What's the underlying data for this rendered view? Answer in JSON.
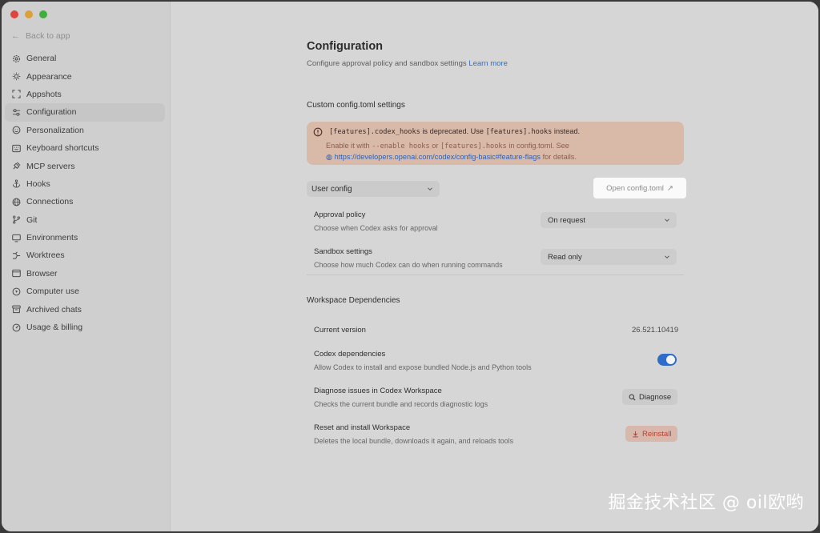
{
  "window": {
    "traffic_lights": [
      "red",
      "yellow",
      "green"
    ]
  },
  "sidebar": {
    "back_label": "Back to app",
    "items": [
      {
        "label": "General",
        "icon": "gear-icon"
      },
      {
        "label": "Appearance",
        "icon": "sun-icon"
      },
      {
        "label": "Appshots",
        "icon": "capture-icon"
      },
      {
        "label": "Configuration",
        "icon": "sliders-icon",
        "active": true
      },
      {
        "label": "Personalization",
        "icon": "smile-icon"
      },
      {
        "label": "Keyboard shortcuts",
        "icon": "keyboard-icon"
      },
      {
        "label": "MCP servers",
        "icon": "plug-icon"
      },
      {
        "label": "Hooks",
        "icon": "anchor-icon"
      },
      {
        "label": "Connections",
        "icon": "globe-icon"
      },
      {
        "label": "Git",
        "icon": "branch-icon"
      },
      {
        "label": "Environments",
        "icon": "monitor-icon"
      },
      {
        "label": "Worktrees",
        "icon": "tree-icon"
      },
      {
        "label": "Browser",
        "icon": "browser-icon"
      },
      {
        "label": "Computer use",
        "icon": "cursor-icon"
      },
      {
        "label": "Archived chats",
        "icon": "archive-icon"
      },
      {
        "label": "Usage & billing",
        "icon": "gauge-icon"
      }
    ]
  },
  "main": {
    "title": "Configuration",
    "subtitle": "Configure approval policy and sandbox settings",
    "learn_more": "Learn more",
    "custom_section": "Custom config.toml settings",
    "warning": {
      "code1": "[features].codex_hooks",
      "text1": "is deprecated. Use",
      "code2": "[features].hooks",
      "text2": "instead.",
      "line2_a": "Enable it with",
      "code3": "--enable hooks",
      "line2_b": "or",
      "code4": "[features].hooks",
      "line2_c": "in config.toml. See",
      "link": "https://developers.openai.com/codex/config-basic#feature-flags",
      "line3_end": "for details."
    },
    "config_select": "User config",
    "open_config_label": "Open config.toml",
    "approval": {
      "title": "Approval policy",
      "desc": "Choose when Codex asks for approval",
      "value": "On request"
    },
    "sandbox": {
      "title": "Sandbox settings",
      "desc": "Choose how much Codex can do when running commands",
      "value": "Read only"
    },
    "workspace_section": "Workspace Dependencies",
    "current_version": {
      "title": "Current version",
      "value": "26.521.10419"
    },
    "codex_deps": {
      "title": "Codex dependencies",
      "desc": "Allow Codex to install and expose bundled Node.js and Python tools",
      "enabled": true
    },
    "diagnose": {
      "title": "Diagnose issues in Codex Workspace",
      "desc": "Checks the current bundle and records diagnostic logs",
      "button": "Diagnose"
    },
    "reset": {
      "title": "Reset and install Workspace",
      "desc": "Deletes the local bundle, downloads it again, and reloads tools",
      "button": "Reinstall"
    }
  },
  "watermark": "掘金技术社区 @ oil欧哟",
  "colors": {
    "accent": "#2f6cc9",
    "danger": "#c0402e",
    "warning_bg": "#d9b9a7"
  }
}
